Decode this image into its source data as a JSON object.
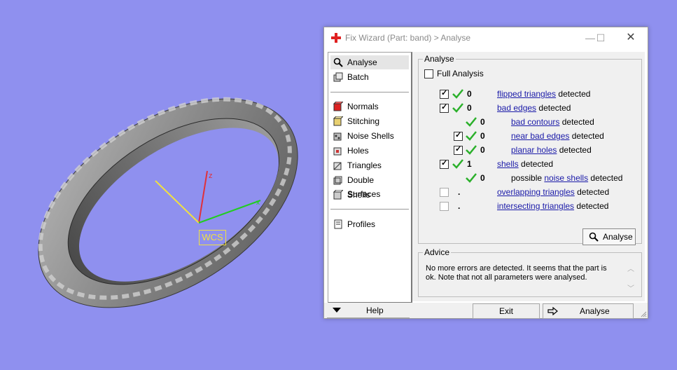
{
  "viewport": {
    "wcs_label": "WCS",
    "axis_z": "z",
    "axis_x": "x"
  },
  "window": {
    "title": "Fix Wizard (Part: band) > Analyse",
    "controls": {
      "minimize": "—",
      "maximize": "☐",
      "close": "✕"
    }
  },
  "nav": {
    "items": [
      {
        "label": "Analyse",
        "icon": "magnifier-icon"
      },
      {
        "label": "Batch",
        "icon": "batch-icon"
      },
      {
        "label": "Normals",
        "icon": "normals-cube-icon"
      },
      {
        "label": "Stitching",
        "icon": "stitching-cube-icon"
      },
      {
        "label": "Noise Shells",
        "icon": "noise-shells-icon"
      },
      {
        "label": "Holes",
        "icon": "holes-cube-icon"
      },
      {
        "label": "Triangles",
        "icon": "triangles-cube-icon"
      },
      {
        "label": "Double Surfaces",
        "icon": "double-surfaces-icon"
      },
      {
        "label": "Shells",
        "icon": "shells-cube-icon"
      },
      {
        "label": "Profiles",
        "icon": "profiles-icon"
      }
    ]
  },
  "analyse": {
    "legend": "Analyse",
    "full_analysis": "Full Analysis",
    "detected": "detected",
    "possible": "possible",
    "rows": [
      {
        "count": "0",
        "link": "flipped triangles"
      },
      {
        "count": "0",
        "link": "bad edges"
      },
      {
        "count": "0",
        "link": "bad contours"
      },
      {
        "count": "0",
        "link": "near bad edges"
      },
      {
        "count": "0",
        "link": "planar holes"
      },
      {
        "count": "1",
        "link": "shells"
      },
      {
        "count": "0",
        "link": "noise shells"
      },
      {
        "count": ".",
        "link": "overlapping triangles"
      },
      {
        "count": ".",
        "link": "intersecting triangles"
      }
    ],
    "button": "Analyse"
  },
  "advice": {
    "legend": "Advice",
    "text": "No more errors are detected. It seems that the part is ok. Note that not all parameters were analysed."
  },
  "footer": {
    "help": "Help",
    "exit": "Exit",
    "analyse": "Analyse"
  },
  "colors": {
    "background": "#8f90ef",
    "link": "#1a1aa8",
    "tick": "#2bb02b",
    "axis_z": "#e0303a",
    "axis_x": "#22cc22",
    "axis_y": "#f0e040"
  }
}
